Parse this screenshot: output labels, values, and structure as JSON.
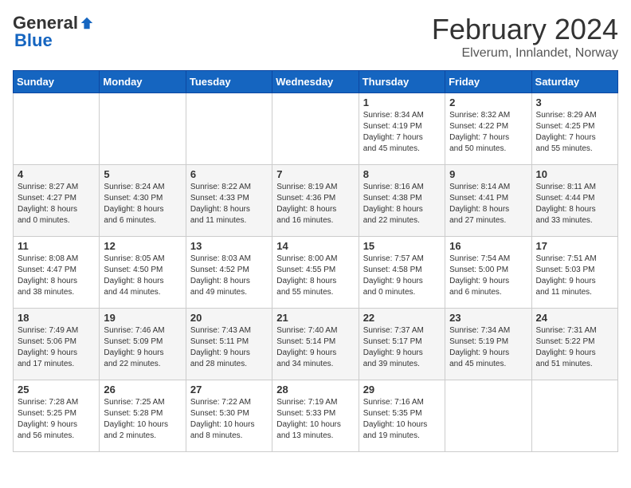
{
  "logo": {
    "general": "General",
    "blue": "Blue"
  },
  "header": {
    "month": "February 2024",
    "location": "Elverum, Innlandet, Norway"
  },
  "weekdays": [
    "Sunday",
    "Monday",
    "Tuesday",
    "Wednesday",
    "Thursday",
    "Friday",
    "Saturday"
  ],
  "weeks": [
    [
      {
        "day": "",
        "info": ""
      },
      {
        "day": "",
        "info": ""
      },
      {
        "day": "",
        "info": ""
      },
      {
        "day": "",
        "info": ""
      },
      {
        "day": "1",
        "info": "Sunrise: 8:34 AM\nSunset: 4:19 PM\nDaylight: 7 hours\nand 45 minutes."
      },
      {
        "day": "2",
        "info": "Sunrise: 8:32 AM\nSunset: 4:22 PM\nDaylight: 7 hours\nand 50 minutes."
      },
      {
        "day": "3",
        "info": "Sunrise: 8:29 AM\nSunset: 4:25 PM\nDaylight: 7 hours\nand 55 minutes."
      }
    ],
    [
      {
        "day": "4",
        "info": "Sunrise: 8:27 AM\nSunset: 4:27 PM\nDaylight: 8 hours\nand 0 minutes."
      },
      {
        "day": "5",
        "info": "Sunrise: 8:24 AM\nSunset: 4:30 PM\nDaylight: 8 hours\nand 6 minutes."
      },
      {
        "day": "6",
        "info": "Sunrise: 8:22 AM\nSunset: 4:33 PM\nDaylight: 8 hours\nand 11 minutes."
      },
      {
        "day": "7",
        "info": "Sunrise: 8:19 AM\nSunset: 4:36 PM\nDaylight: 8 hours\nand 16 minutes."
      },
      {
        "day": "8",
        "info": "Sunrise: 8:16 AM\nSunset: 4:38 PM\nDaylight: 8 hours\nand 22 minutes."
      },
      {
        "day": "9",
        "info": "Sunrise: 8:14 AM\nSunset: 4:41 PM\nDaylight: 8 hours\nand 27 minutes."
      },
      {
        "day": "10",
        "info": "Sunrise: 8:11 AM\nSunset: 4:44 PM\nDaylight: 8 hours\nand 33 minutes."
      }
    ],
    [
      {
        "day": "11",
        "info": "Sunrise: 8:08 AM\nSunset: 4:47 PM\nDaylight: 8 hours\nand 38 minutes."
      },
      {
        "day": "12",
        "info": "Sunrise: 8:05 AM\nSunset: 4:50 PM\nDaylight: 8 hours\nand 44 minutes."
      },
      {
        "day": "13",
        "info": "Sunrise: 8:03 AM\nSunset: 4:52 PM\nDaylight: 8 hours\nand 49 minutes."
      },
      {
        "day": "14",
        "info": "Sunrise: 8:00 AM\nSunset: 4:55 PM\nDaylight: 8 hours\nand 55 minutes."
      },
      {
        "day": "15",
        "info": "Sunrise: 7:57 AM\nSunset: 4:58 PM\nDaylight: 9 hours\nand 0 minutes."
      },
      {
        "day": "16",
        "info": "Sunrise: 7:54 AM\nSunset: 5:00 PM\nDaylight: 9 hours\nand 6 minutes."
      },
      {
        "day": "17",
        "info": "Sunrise: 7:51 AM\nSunset: 5:03 PM\nDaylight: 9 hours\nand 11 minutes."
      }
    ],
    [
      {
        "day": "18",
        "info": "Sunrise: 7:49 AM\nSunset: 5:06 PM\nDaylight: 9 hours\nand 17 minutes."
      },
      {
        "day": "19",
        "info": "Sunrise: 7:46 AM\nSunset: 5:09 PM\nDaylight: 9 hours\nand 22 minutes."
      },
      {
        "day": "20",
        "info": "Sunrise: 7:43 AM\nSunset: 5:11 PM\nDaylight: 9 hours\nand 28 minutes."
      },
      {
        "day": "21",
        "info": "Sunrise: 7:40 AM\nSunset: 5:14 PM\nDaylight: 9 hours\nand 34 minutes."
      },
      {
        "day": "22",
        "info": "Sunrise: 7:37 AM\nSunset: 5:17 PM\nDaylight: 9 hours\nand 39 minutes."
      },
      {
        "day": "23",
        "info": "Sunrise: 7:34 AM\nSunset: 5:19 PM\nDaylight: 9 hours\nand 45 minutes."
      },
      {
        "day": "24",
        "info": "Sunrise: 7:31 AM\nSunset: 5:22 PM\nDaylight: 9 hours\nand 51 minutes."
      }
    ],
    [
      {
        "day": "25",
        "info": "Sunrise: 7:28 AM\nSunset: 5:25 PM\nDaylight: 9 hours\nand 56 minutes."
      },
      {
        "day": "26",
        "info": "Sunrise: 7:25 AM\nSunset: 5:28 PM\nDaylight: 10 hours\nand 2 minutes."
      },
      {
        "day": "27",
        "info": "Sunrise: 7:22 AM\nSunset: 5:30 PM\nDaylight: 10 hours\nand 8 minutes."
      },
      {
        "day": "28",
        "info": "Sunrise: 7:19 AM\nSunset: 5:33 PM\nDaylight: 10 hours\nand 13 minutes."
      },
      {
        "day": "29",
        "info": "Sunrise: 7:16 AM\nSunset: 5:35 PM\nDaylight: 10 hours\nand 19 minutes."
      },
      {
        "day": "",
        "info": ""
      },
      {
        "day": "",
        "info": ""
      }
    ]
  ]
}
